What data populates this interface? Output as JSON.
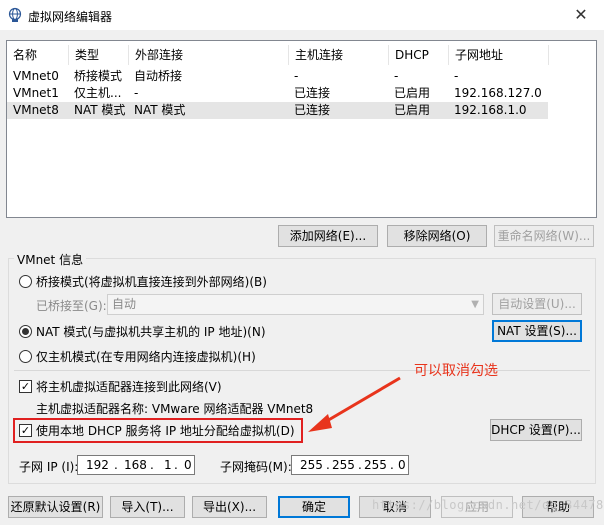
{
  "window": {
    "title": "虚拟网络编辑器",
    "close_glyph": "✕"
  },
  "table": {
    "headers": [
      "名称",
      "类型",
      "外部连接",
      "主机连接",
      "DHCP",
      "子网地址"
    ],
    "rows": [
      [
        "VMnet0",
        "桥接模式",
        "自动桥接",
        "-",
        "-",
        "-"
      ],
      [
        "VMnet1",
        "仅主机...",
        "-",
        "已连接",
        "已启用",
        "192.168.127.0"
      ],
      [
        "VMnet8",
        "NAT 模式",
        "NAT 模式",
        "已连接",
        "已启用",
        "192.168.1.0"
      ]
    ],
    "selected_row": 2
  },
  "table_buttons": {
    "add": "添加网络(E)...",
    "remove": "移除网络(O)",
    "rename": "重命名网络(W)..."
  },
  "vmnet_info": {
    "title": "VMnet 信息",
    "bridge_label": "桥接模式(将虚拟机直接连接到外部网络)(B)",
    "bridged_to_label": "已桥接至(G):",
    "bridged_to_value": "自动",
    "auto_settings": "自动设置(U)...",
    "nat_label": "NAT 模式(与虚拟机共享主机的 IP 地址)(N)",
    "nat_settings": "NAT 设置(S)...",
    "hostonly_label": "仅主机模式(在专用网络内连接虚拟机)(H)",
    "selected_mode": "nat",
    "connect_adapter_label": "将主机虚拟适配器连接到此网络(V)",
    "connect_adapter_checked": true,
    "adapter_name_label": "主机虚拟适配器名称: VMware 网络适配器 VMnet8",
    "dhcp_label": "使用本地 DHCP 服务将 IP 地址分配给虚拟机(D)",
    "dhcp_checked": true,
    "dhcp_settings": "DHCP 设置(P)...",
    "subnet_ip_label": "子网 IP (I):",
    "subnet_ip": [
      "192",
      "168",
      "1",
      "0"
    ],
    "subnet_mask_label": "子网掩码(M):",
    "subnet_mask": [
      "255",
      "255",
      "255",
      "0"
    ]
  },
  "annotation": {
    "text": "可以取消勾选",
    "color": "#e8341c"
  },
  "bottom_buttons": {
    "restore": "还原默认设置(R)",
    "import": "导入(T)...",
    "export": "导出(X)...",
    "ok": "确定",
    "cancel": "取消",
    "apply": "应用",
    "help": "帮助"
  },
  "watermark": "https://blog.csdn.net/qq_34478766",
  "icons": {
    "title_icon": "globe-network-icon",
    "close": "close-icon",
    "dropdown": "chevron-down-icon",
    "check": "checkmark-icon"
  }
}
